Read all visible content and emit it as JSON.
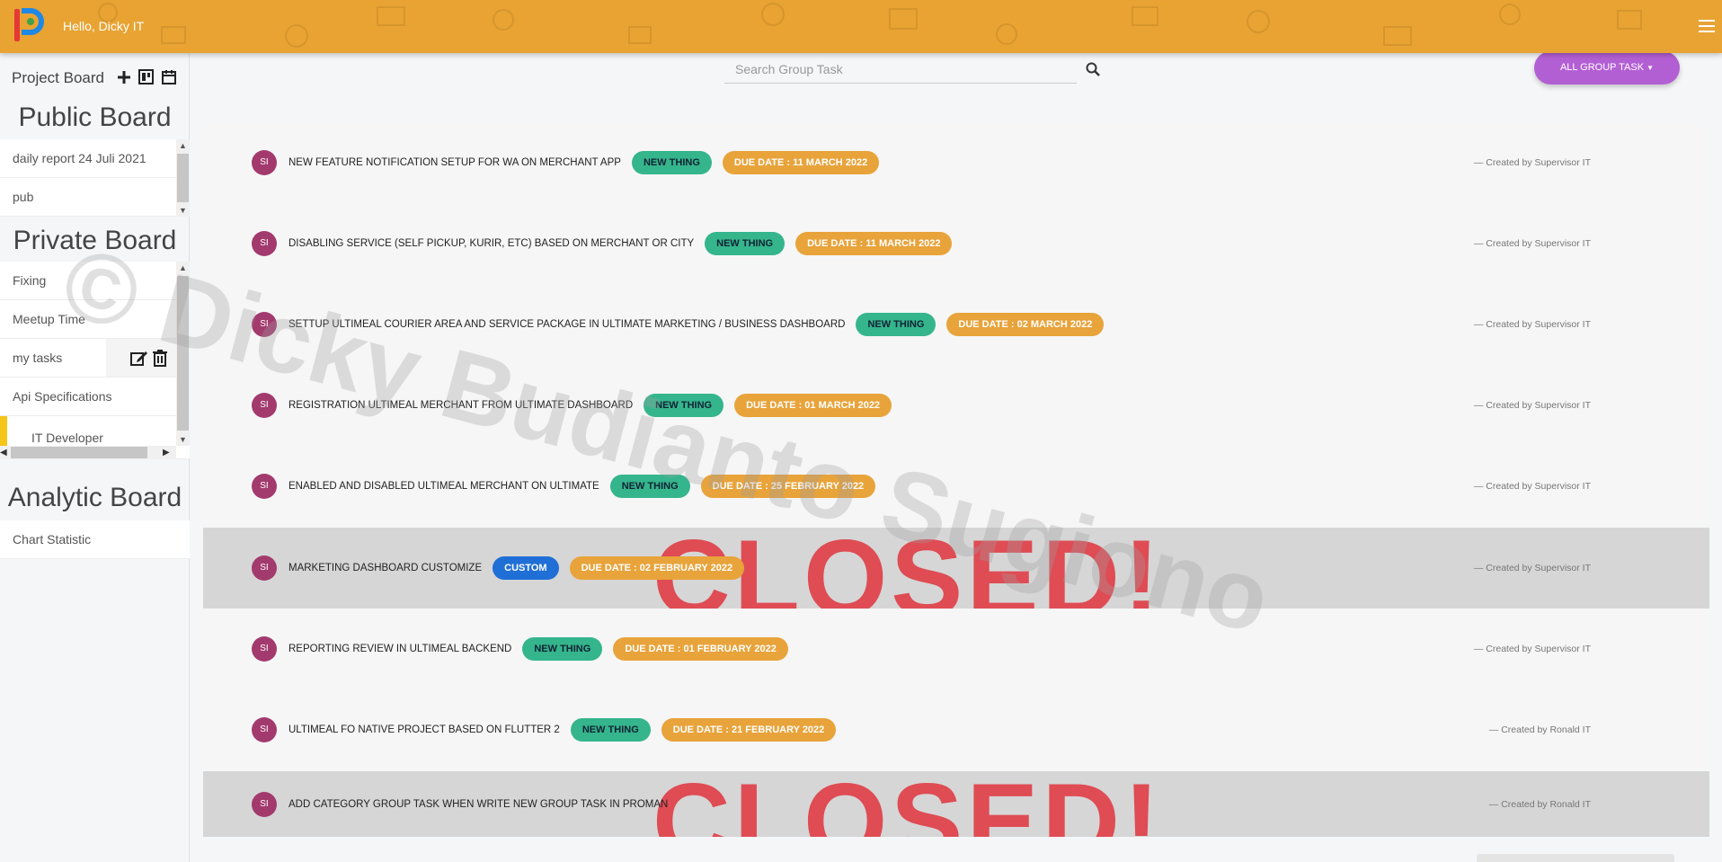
{
  "header": {
    "greeting": "Hello, Dicky IT"
  },
  "sidebar": {
    "heading": "Project Board",
    "icons": [
      "plus-icon",
      "board-icon",
      "calendar-icon"
    ],
    "public_board": {
      "title": "Public Board",
      "items": [
        {
          "label": "daily report 24 Juli 2021"
        },
        {
          "label": "pub"
        }
      ]
    },
    "private_board": {
      "title": "Private Board",
      "items": [
        {
          "label": "Fixing"
        },
        {
          "label": "Meetup Time"
        },
        {
          "label": "my tasks"
        },
        {
          "label": "Api Specifications"
        },
        {
          "label": "IT Developer"
        }
      ]
    },
    "analytic_board": {
      "title": "Analytic Board",
      "items": [
        {
          "label": "Chart Statistic"
        }
      ]
    }
  },
  "search": {
    "placeholder": "Search Group Task",
    "value": ""
  },
  "filter": {
    "label": "ALL GROUP TASK"
  },
  "tasks": [
    {
      "initials": "SI",
      "title": "NEW FEATURE NOTIFICATION SETUP FOR WA ON MERCHANT APP",
      "tag": "NEW THING",
      "due": "DUE DATE : 11 MARCH 2022",
      "creator": "— Created by Supervisor IT",
      "closed": false
    },
    {
      "initials": "SI",
      "title": "DISABLING SERVICE (SELF PICKUP, KURIR, ETC) BASED ON MERCHANT OR CITY",
      "tag": "NEW THING",
      "due": "DUE DATE : 11 MARCH 2022",
      "creator": "— Created by Supervisor IT",
      "closed": false
    },
    {
      "initials": "SI",
      "title": "SETTUP ULTIMEAL COURIER AREA AND SERVICE PACKAGE IN ULTIMATE MARKETING / BUSINESS DASHBOARD",
      "tag": "NEW THING",
      "due": "DUE DATE : 02 MARCH 2022",
      "creator": "— Created by Supervisor IT",
      "closed": false
    },
    {
      "initials": "SI",
      "title": "REGISTRATION ULTIMEAL MERCHANT FROM ULTIMATE DASHBOARD",
      "tag": "NEW THING",
      "due": "DUE DATE : 01 MARCH 2022",
      "creator": "— Created by Supervisor IT",
      "closed": false
    },
    {
      "initials": "SI",
      "title": "ENABLED AND DISABLED ULTIMEAL MERCHANT ON ULTIMATE",
      "tag": "NEW THING",
      "due": "DUE DATE : 25 FEBRUARY 2022",
      "creator": "— Created by Supervisor IT",
      "closed": false
    },
    {
      "initials": "SI",
      "title": "MARKETING DASHBOARD CUSTOMIZE",
      "tag": "CUSTOM",
      "due": "DUE DATE : 02 FEBRUARY 2022",
      "creator": "— Created by Supervisor IT",
      "closed": true
    },
    {
      "initials": "SI",
      "title": "REPORTING REVIEW IN ULTIMEAL BACKEND",
      "tag": "NEW THING",
      "due": "DUE DATE : 01 FEBRUARY 2022",
      "creator": "— Created by Supervisor IT",
      "closed": false
    },
    {
      "initials": "SI",
      "title": "ULTIMEAL FO NATIVE PROJECT BASED ON FLUTTER 2",
      "tag": "NEW THING",
      "due": "DUE DATE : 21 FEBRUARY 2022",
      "creator": "— Created by Ronald IT",
      "closed": false
    },
    {
      "initials": "SI",
      "title": "ADD CATEGORY GROUP TASK WHEN WRITE NEW GROUP TASK IN PROMAN",
      "tag": "",
      "due": "",
      "creator": "— Created by Ronald IT",
      "closed": true
    }
  ],
  "stamp_text": "CLOSED!",
  "watermark": "© Dicky Budianto Sugiono",
  "colors": {
    "header": "#e8a333",
    "filter_button": "#b35fd4",
    "tag_new_thing": "#35b58c",
    "tag_custom": "#1f6fd6",
    "due_date": "#e8a33a",
    "avatar": "#a33a6e",
    "closed_stamp": "#e0454e"
  }
}
